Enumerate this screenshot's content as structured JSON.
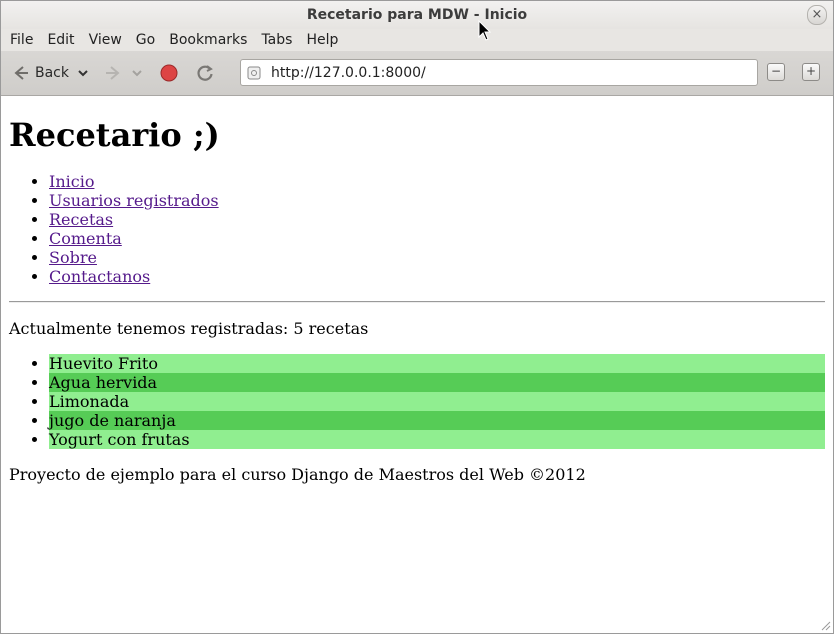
{
  "window": {
    "title": "Recetario para MDW - Inicio",
    "close_glyph": "×"
  },
  "menubar": [
    "File",
    "Edit",
    "View",
    "Go",
    "Bookmarks",
    "Tabs",
    "Help"
  ],
  "toolbar": {
    "back_label": "Back",
    "url": "http://127.0.0.1:8000/",
    "zoom_out_glyph": "−",
    "zoom_in_glyph": "+"
  },
  "page": {
    "heading": "Recetario ;)",
    "nav": [
      "Inicio",
      "Usuarios registrados",
      "Recetas",
      "Comenta",
      "Sobre",
      "Contactanos"
    ],
    "count_text": "Actualmente tenemos registradas: 5 recetas",
    "recipes": [
      "Huevito Frito",
      "Agua hervida",
      "Limonada",
      "jugo de naranja",
      "Yogurt con frutas"
    ],
    "footer": "Proyecto de ejemplo para el curso Django de Maestros del Web ©2012"
  },
  "colors": {
    "link_visited": "#551a8b",
    "row_light": "#90ee90",
    "row_dark": "#56cc56",
    "stop_button": "#d44"
  }
}
